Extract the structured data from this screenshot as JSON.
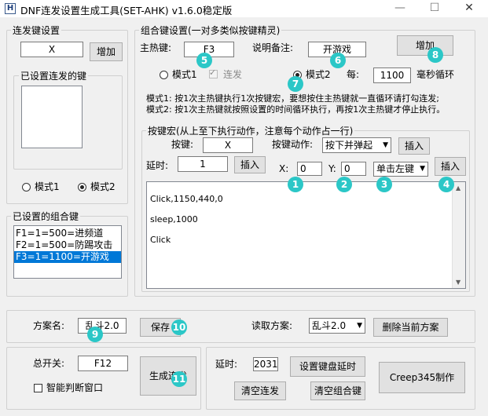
{
  "window": {
    "title": "DNF连发设置生成工具(SET-AHK) v1.6.0稳定版",
    "icon_glyph": "H",
    "minimize_glyph": "—",
    "maximize_glyph": "☐",
    "close_glyph": "✕"
  },
  "burst": {
    "title": "连发键设置",
    "key_value": "X",
    "add_label": "增加",
    "set_keys_title": "已设置连发的键",
    "set_keys": [],
    "mode1_label": "模式1",
    "mode2_label": "模式2",
    "selected_mode": "mode2"
  },
  "combos": {
    "title": "已设置的组合键",
    "items": [
      "F1=1=500=进频道",
      "F2=1=500=防踢攻击",
      "F3=1=1100=开游戏"
    ],
    "selected_index": 2
  },
  "combo_settings": {
    "title": "组合键设置(一对多类似按键精灵)",
    "hotkey_label": "主热键:",
    "hotkey_value": "F3",
    "note_label": "说明备注:",
    "note_value": "开游戏",
    "add_label": "增加",
    "mode1_label": "模式1",
    "repeat_label": "连发",
    "mode2_label": "模式2",
    "selected_mode": "mode2",
    "every_label": "每:",
    "interval_value": "1100",
    "interval_unit": "毫秒循环",
    "desc_mode1": "模式1: 按1次主热键执行1次按键宏，要想按住主热键就一直循环请打勾连发;",
    "desc_mode2": "模式2: 按1次主热键就按照设置的时间循环执行，再按1次主热键才停止执行。"
  },
  "macro": {
    "title": "按键宏(从上至下执行动作，注意每个动作占一行)",
    "key_label": "按键:",
    "key_value": "X",
    "action_label": "按键动作:",
    "action_value": "按下并弹起",
    "insert_label": "插入",
    "delay_label": "延时:",
    "delay_value": "1",
    "insert2_label": "插入",
    "x_label": "X:",
    "x_value": "0",
    "y_label": "Y:",
    "y_value": "0",
    "click_value": "单击左键",
    "insert3_label": "插入",
    "script_lines": [
      "Click,1150,440,0",
      "sleep,1000",
      "Click"
    ]
  },
  "scheme": {
    "name_label": "方案名:",
    "name_value": "乱斗2.0",
    "save_label": "保存",
    "load_label": "读取方案:",
    "load_value": "乱斗2.0",
    "delete_label": "删除当前方案"
  },
  "bottom": {
    "switch_label": "总开关:",
    "switch_value": "F12",
    "generate_label": "生成连发",
    "smart_label": "智能判断窗口",
    "delay_label": "延时:",
    "delay_value": "2031",
    "set_delay_label": "设置键盘延时",
    "clear_burst_label": "清空连发",
    "clear_combo_label": "清空组合键",
    "credit_label": "Creep345制作"
  },
  "badges": [
    "1",
    "2",
    "3",
    "4",
    "5",
    "6",
    "7",
    "8",
    "9",
    "10",
    "11"
  ]
}
